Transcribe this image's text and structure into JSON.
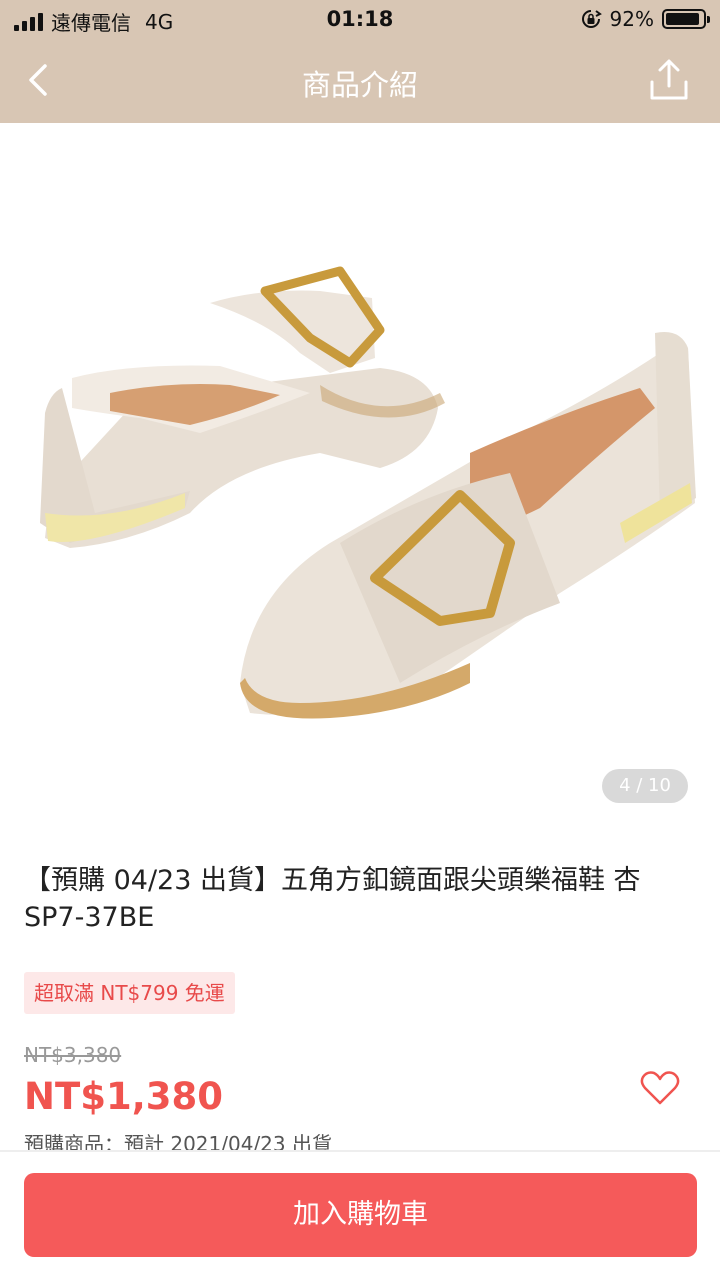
{
  "status_bar": {
    "carrier": "遠傳電信",
    "network": "4G",
    "time": "01:18",
    "battery": "92%",
    "battery_level": 0.92
  },
  "nav": {
    "title": "商品介紹",
    "back_icon": "chevron-left-icon",
    "share_icon": "share-icon"
  },
  "gallery": {
    "counter": "4 / 10"
  },
  "product": {
    "title": "【預購 04/23 出貨】五角方釦鏡面跟尖頭樂福鞋 杏 SP7-37BE",
    "promo": "超取滿 NT$799 免運",
    "original_price": "NT$3,380",
    "price": "NT$1,380",
    "preorder_note": "預購商品：預計 2021/04/23 出貨"
  },
  "actions": {
    "add_to_cart": "加入購物車"
  },
  "colors": {
    "header_bg": "#d8c6b4",
    "accent": "#f0544f",
    "button_bg": "#f55a5a"
  }
}
